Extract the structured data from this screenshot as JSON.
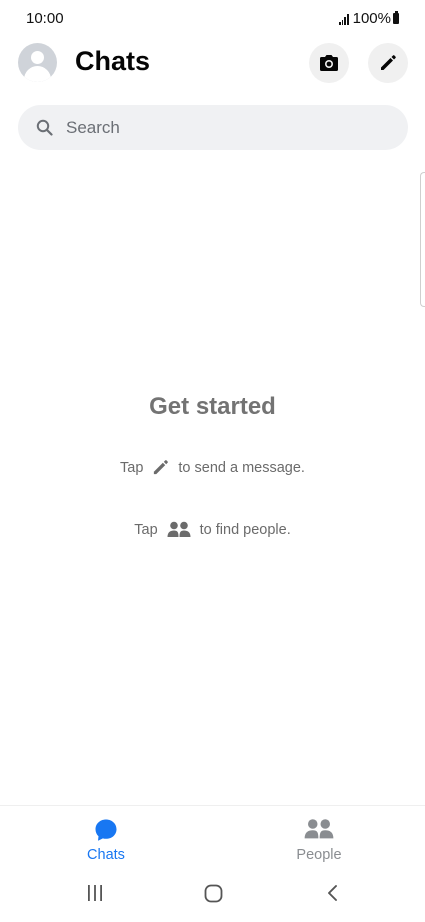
{
  "status_bar": {
    "time": "10:00",
    "battery": "100%"
  },
  "header": {
    "title": "Chats",
    "avatar_icon": "default-avatar",
    "camera_icon": "camera-icon",
    "compose_icon": "pencil-icon"
  },
  "search": {
    "placeholder": "Search",
    "value": ""
  },
  "empty_state": {
    "title": "Get started",
    "hint_compose": {
      "prefix": "Tap",
      "icon": "pencil-icon",
      "suffix": "to send a message."
    },
    "hint_people": {
      "prefix": "Tap",
      "icon": "people-icon",
      "suffix": "to find people."
    }
  },
  "bottom_nav": {
    "tabs": [
      {
        "label": "Chats",
        "icon": "chat-bubble-icon",
        "active": true
      },
      {
        "label": "People",
        "icon": "people-icon",
        "active": false
      }
    ]
  },
  "system_nav": {
    "buttons": [
      "recent-apps",
      "home",
      "back"
    ]
  },
  "colors": {
    "accent": "#1877f2",
    "inactive": "#8a8d91",
    "muted_text": "#737373",
    "search_bg": "#f0f1f3"
  }
}
